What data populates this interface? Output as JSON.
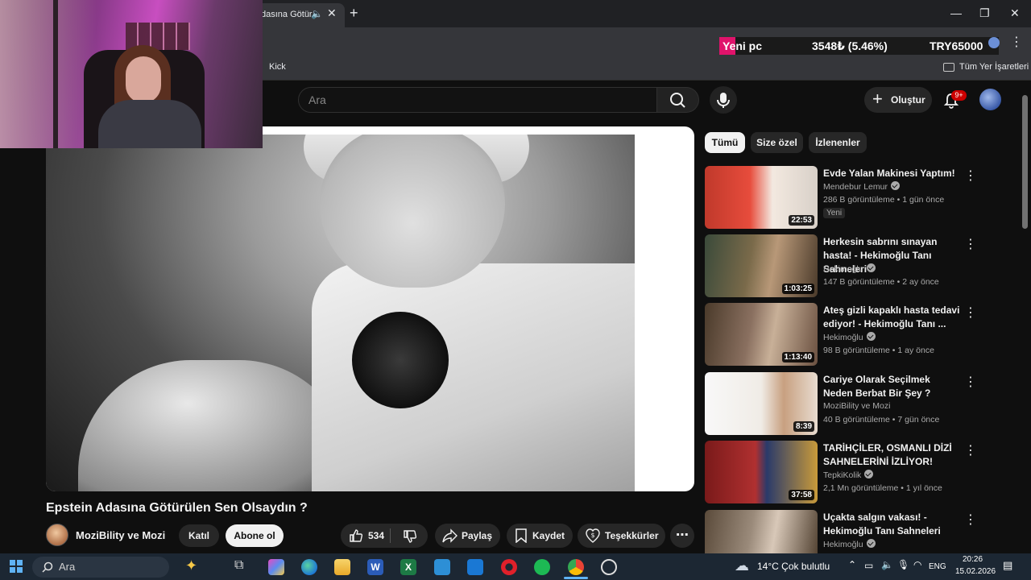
{
  "browser": {
    "tab_title": "dasına Götür",
    "bookmarks": {
      "kick": "Kick",
      "all_bookmarks": "Tüm Yer İşaretleri"
    }
  },
  "ticker": {
    "name": "Yeni pc",
    "change": "3548₺ (5.46%)",
    "price": "TRY65000"
  },
  "header": {
    "search_placeholder": "Ara",
    "create_label": "Oluştur",
    "notifications_badge": "9+"
  },
  "video": {
    "title": "Epstein Adasına Götürülen Sen Olsaydın ?",
    "channel": "MoziBility ve Mozi",
    "join_label": "Katıl",
    "subscribe_label": "Abone ol",
    "likes": "534",
    "share_label": "Paylaş",
    "save_label": "Kaydet",
    "thanks_label": "Teşekkürler"
  },
  "chips": [
    "Tümü",
    "Size özel",
    "İzlenenler"
  ],
  "recommendations": [
    {
      "title": "Evde Yalan Makinesi Yaptım!",
      "channel": "Mendebur Lemur",
      "meta": "286 B görüntüleme • 1 gün önce",
      "duration": "22:53",
      "badge": "Yeni"
    },
    {
      "title": "Herkesin sabrını sınayan hasta! - Hekimoğlu Tanı Sahneleri",
      "channel": "Hekimoğlu",
      "meta": "147 B görüntüleme • 2 ay önce",
      "duration": "1:03:25"
    },
    {
      "title": "Ateş gizli kapaklı hasta tedavi ediyor! - Hekimoğlu Tanı ...",
      "channel": "Hekimoğlu",
      "meta": "98 B görüntüleme • 1 ay önce",
      "duration": "1:13:40"
    },
    {
      "title": "Cariye Olarak Seçilmek Neden Berbat Bir Şey ?",
      "channel": "MoziBility ve Mozi",
      "meta": "40 B görüntüleme • 7 gün önce",
      "duration": "8:39"
    },
    {
      "title": "TARİHÇİLER, OSMANLI DİZİ SAHNELERİNİ İZLİYOR!",
      "channel": "TepkiKolik",
      "meta": "2,1 Mn görüntüleme • 1 yıl önce",
      "duration": "37:58"
    },
    {
      "title": "Uçakta salgın vakası! - Hekimoğlu Tanı Sahneleri",
      "channel": "Hekimoğlu",
      "meta": "",
      "duration": ""
    }
  ],
  "taskbar": {
    "search_placeholder": "Ara",
    "weather": "14°C  Çok bulutlu",
    "language": "ENG",
    "time": "20:26",
    "date": "15.02.2026"
  },
  "colors": {
    "youtube_bg": "#0f0f0f",
    "accent_red": "#cc0000",
    "ticker_pink": "#e0136b"
  }
}
